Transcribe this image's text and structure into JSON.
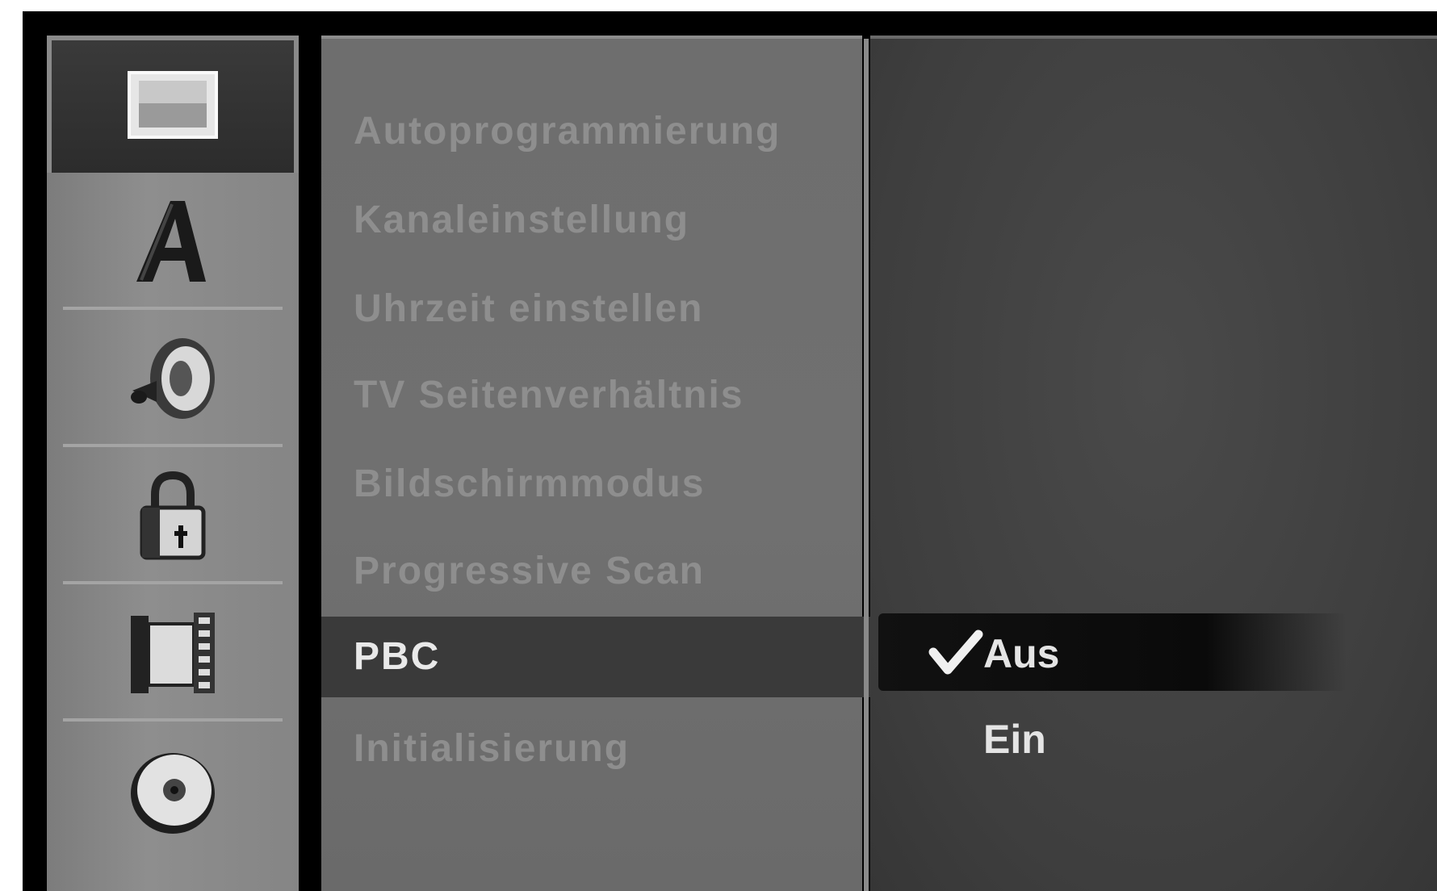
{
  "sidebar": {
    "items": [
      {
        "icon": "tv-screen-icon",
        "active": true
      },
      {
        "icon": "language-a-icon",
        "active": false
      },
      {
        "icon": "speaker-icon",
        "active": false
      },
      {
        "icon": "padlock-icon",
        "active": false
      },
      {
        "icon": "film-reel-icon",
        "active": false
      },
      {
        "icon": "disc-icon",
        "active": false
      }
    ]
  },
  "menu": {
    "items": [
      {
        "label": "Autoprogrammierung"
      },
      {
        "label": "Kanaleinstellung"
      },
      {
        "label": "Uhrzeit einstellen"
      },
      {
        "label": "TV Seitenverhältnis"
      },
      {
        "label": "Bildschirmmodus"
      },
      {
        "label": "Progressive Scan"
      },
      {
        "label": "PBC",
        "selected": true
      },
      {
        "label": "Initialisierung"
      }
    ]
  },
  "options": {
    "items": [
      {
        "label": "Aus",
        "checked": true
      },
      {
        "label": "Ein",
        "checked": false
      }
    ]
  },
  "colors": {
    "background": "#000000",
    "sidebar": "#858585",
    "menu_panel": "#6e6e6e",
    "options_panel": "#404040",
    "highlight": "#111111",
    "text_dim": "#8e8e8e",
    "text_bright": "#e9e9e9"
  }
}
